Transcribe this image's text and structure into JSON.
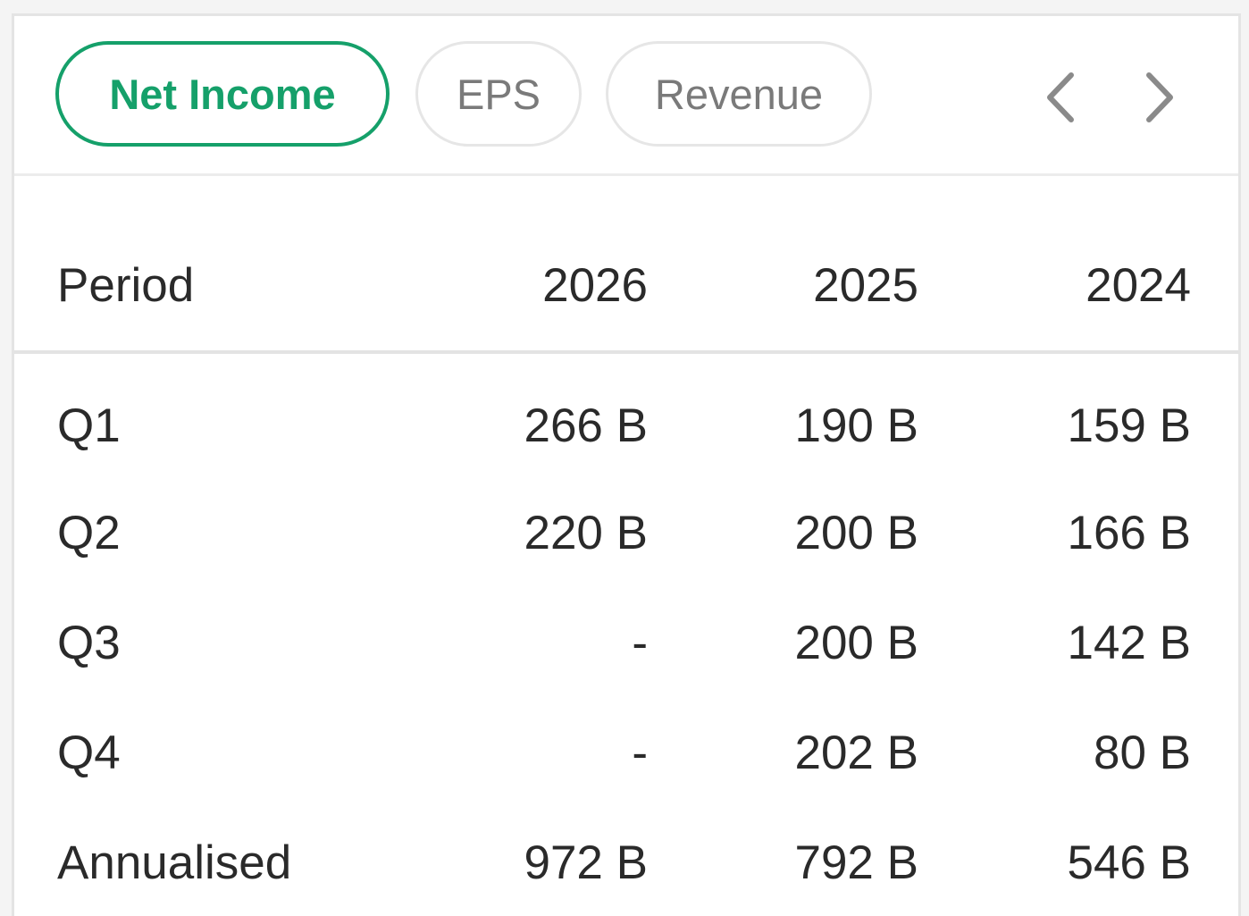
{
  "tabs": [
    {
      "label": "Net Income",
      "active": true
    },
    {
      "label": "EPS",
      "active": false
    },
    {
      "label": "Revenue",
      "active": false
    }
  ],
  "nav": {
    "prev_icon": "chevron-left-icon",
    "next_icon": "chevron-right-icon"
  },
  "colors": {
    "accent": "#15a06a",
    "inactive_text": "#7a7a7a",
    "text": "#2a2a2a",
    "border": "#e4e4e4"
  },
  "table": {
    "headers": [
      "Period",
      "2026",
      "2025",
      "2024"
    ],
    "rows": [
      [
        "Q1",
        "266 B",
        "190 B",
        "159 B"
      ],
      [
        "Q2",
        "220 B",
        "200 B",
        "166 B"
      ],
      [
        "Q3",
        "-",
        "200 B",
        "142 B"
      ],
      [
        "Q4",
        "-",
        "202 B",
        "80 B"
      ],
      [
        "Annualised",
        "972 B",
        "792 B",
        "546 B"
      ]
    ]
  }
}
